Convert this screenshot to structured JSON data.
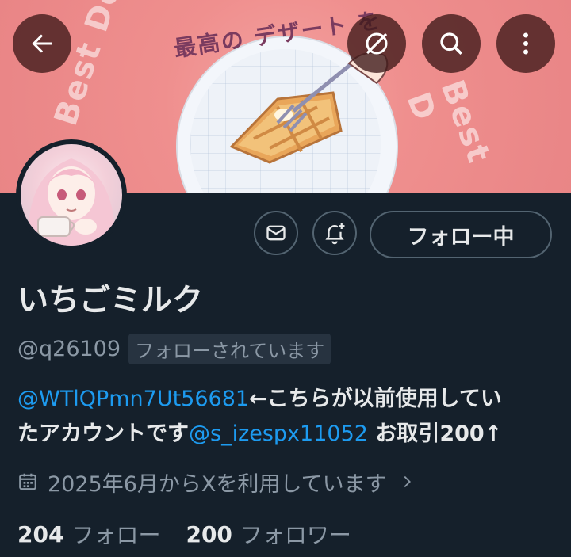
{
  "banner": {
    "ring_text_left": "Best Des",
    "ring_text_top": "最高の デザート を",
    "ring_text_right": "Best D"
  },
  "header": {
    "back_icon": "arrow-left-icon",
    "grok_icon": "grok-icon",
    "search_icon": "search-icon",
    "more_icon": "more-vertical-icon"
  },
  "profile": {
    "display_name": "いちごミルク",
    "handle": "@q26109",
    "follows_you": "フォローされています",
    "following_button": "フォロー中",
    "bio": {
      "mention1": "@WTlQPmn7Ut56681",
      "text1": "←こちらが以前使用してい",
      "text2": "たアカウントです",
      "mention2": "@s_izespx11052",
      "text3": " お取引200↑"
    },
    "joined": "2025年6月からXを利用しています",
    "stats": {
      "following_count": "204",
      "following_label": "フォロー",
      "followers_count": "200",
      "followers_label": "フォロワー"
    }
  },
  "colors": {
    "background": "#15202b",
    "link": "#1d9bf0",
    "muted": "#8b98a5",
    "banner_pink": "#ef8f8e"
  }
}
